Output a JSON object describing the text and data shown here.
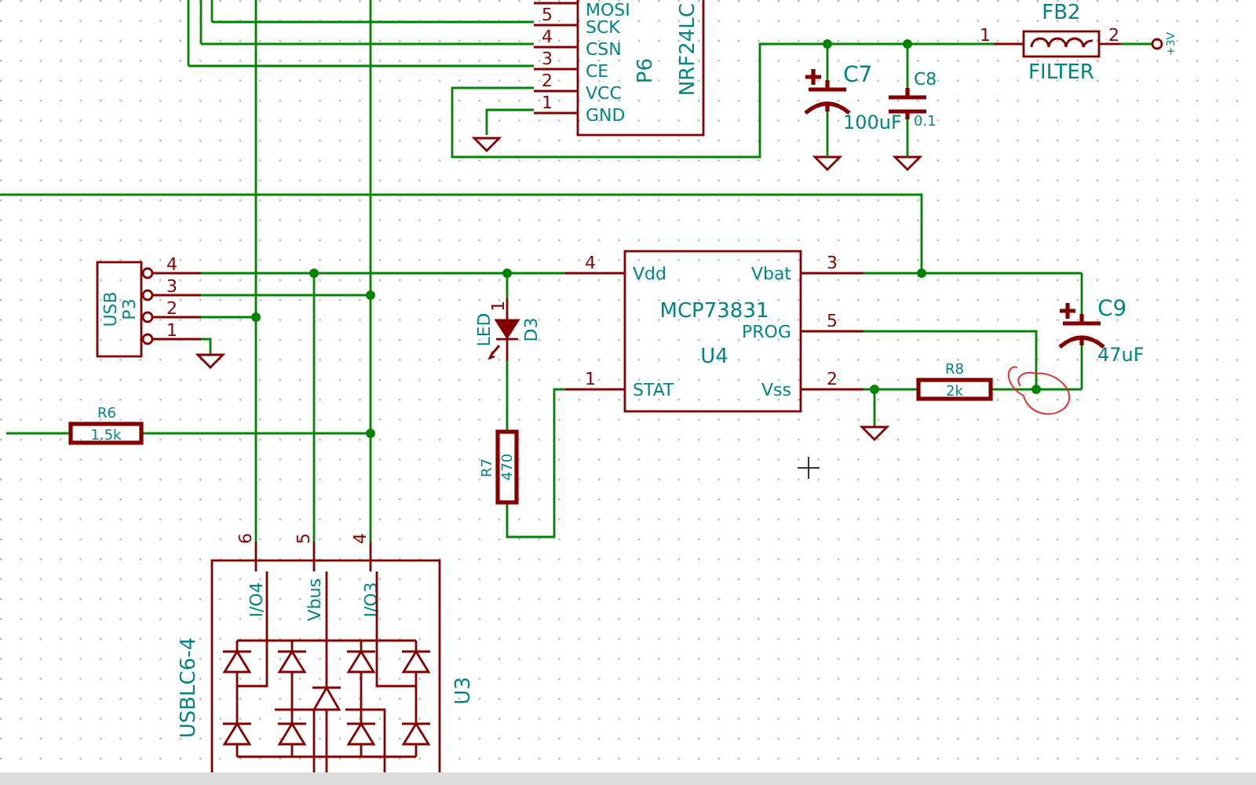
{
  "nrf24": {
    "ref": "P6",
    "value": "NRF24LC",
    "pins": [
      {
        "name": "MOSI"
      },
      {
        "number": "5",
        "name": "SCK"
      },
      {
        "number": "4",
        "name": "CSN"
      },
      {
        "number": "3",
        "name": "CE"
      },
      {
        "number": "2",
        "name": "VCC"
      },
      {
        "number": "1",
        "name": "GND"
      }
    ]
  },
  "filter": {
    "ref": "FB2",
    "value": "FILTER",
    "pins": [
      "1",
      "2"
    ],
    "net_label": "+3V"
  },
  "capacitors": [
    {
      "ref": "C7",
      "value": "100uF",
      "polarized": true
    },
    {
      "ref": "C8",
      "value": "0.1",
      "polarized": false
    },
    {
      "ref": "C9",
      "value": "47uF",
      "polarized": true
    }
  ],
  "usb_connector": {
    "ref": "P3",
    "value": "USB",
    "pins": [
      "4",
      "3",
      "2",
      "1"
    ]
  },
  "resistors": [
    {
      "ref": "R6",
      "value": "1.5k"
    },
    {
      "ref": "R7",
      "value": "470"
    },
    {
      "ref": "R8",
      "value": "2k"
    }
  ],
  "led": {
    "ref": "D3",
    "value": "LED",
    "pin": "1"
  },
  "charger": {
    "ref": "U4",
    "value": "MCP73831",
    "pins": [
      {
        "number": "4",
        "name": "Vdd"
      },
      {
        "number": "3",
        "name": "Vbat"
      },
      {
        "number": "5",
        "name": "PROG"
      },
      {
        "number": "1",
        "name": "STAT"
      },
      {
        "number": "2",
        "name": "Vss"
      }
    ]
  },
  "esd": {
    "ref": "U3",
    "value": "USBLC6-4",
    "pins": [
      {
        "number": "6",
        "name": "I/O4"
      },
      {
        "number": "5",
        "name": "Vbus"
      },
      {
        "number": "4",
        "name": "I/O3"
      }
    ]
  }
}
